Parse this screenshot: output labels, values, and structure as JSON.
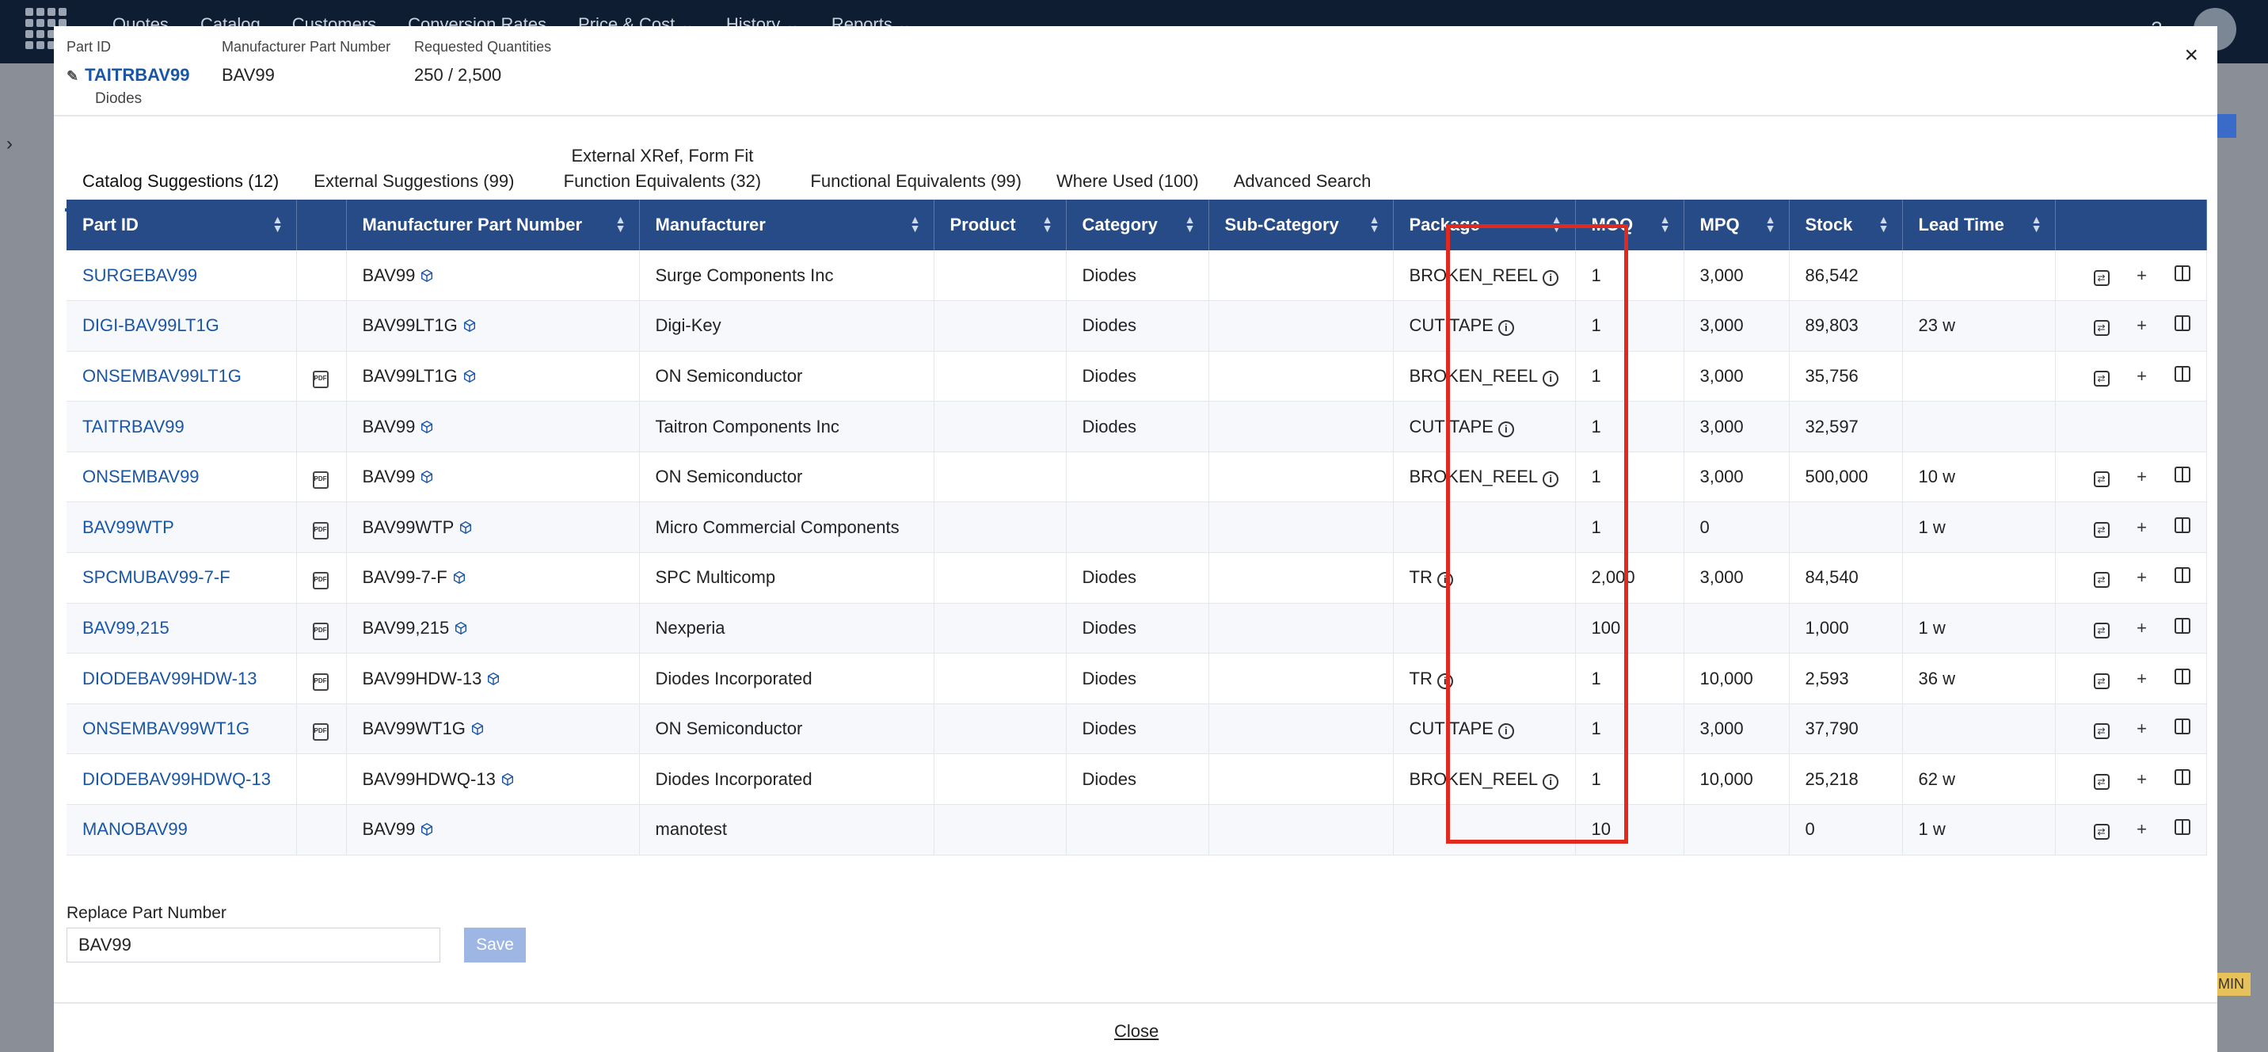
{
  "background": {
    "nav": [
      "Quotes",
      "Catalog",
      "Customers",
      "Conversion Rates",
      "Price & Cost ⌄",
      "History ⌄",
      "Reports ⌄"
    ],
    "badge": "MIN"
  },
  "header": {
    "part_id_label": "Part ID",
    "part_id": "TAITRBAV99",
    "part_category": "Diodes",
    "mpn_label": "Manufacturer Part Number",
    "mpn": "BAV99",
    "qty_label": "Requested Quantities",
    "qty": "250 / 2,500",
    "close_icon": "×"
  },
  "tabs": [
    {
      "label": "Catalog Suggestions (12)",
      "active": true
    },
    {
      "label": "External Suggestions (99)"
    },
    {
      "label": "External XRef, Form Fit Function Equivalents (32)"
    },
    {
      "label": "Functional Equivalents (99)"
    },
    {
      "label": "Where Used (100)"
    },
    {
      "label": "Advanced Search"
    }
  ],
  "table": {
    "columns": [
      "Part ID",
      "",
      "Manufacturer Part Number",
      "Manufacturer",
      "Product",
      "Category",
      "Sub-Category",
      "Package",
      "MOQ",
      "MPQ",
      "Stock",
      "Lead Time",
      ""
    ],
    "rows": [
      {
        "part_id": "SURGEBAV99",
        "pdf": false,
        "mpn": "BAV99",
        "mfr": "Surge Components Inc",
        "product": "",
        "category": "Diodes",
        "sub": "",
        "package": "BROKEN_REEL",
        "moq": "1",
        "mpq": "3,000",
        "stock": "86,542",
        "lead": "",
        "actions": true
      },
      {
        "part_id": "DIGI-BAV99LT1G",
        "pdf": false,
        "mpn": "BAV99LT1G",
        "mfr": "Digi-Key",
        "product": "",
        "category": "Diodes",
        "sub": "",
        "package": "CUT TAPE",
        "moq": "1",
        "mpq": "3,000",
        "stock": "89,803",
        "lead": "23 w",
        "actions": true
      },
      {
        "part_id": "ONSEMBAV99LT1G",
        "pdf": true,
        "mpn": "BAV99LT1G",
        "mfr": "ON Semiconductor",
        "product": "",
        "category": "Diodes",
        "sub": "",
        "package": "BROKEN_REEL",
        "moq": "1",
        "mpq": "3,000",
        "stock": "35,756",
        "lead": "",
        "actions": true
      },
      {
        "part_id": "TAITRBAV99",
        "pdf": false,
        "mpn": "BAV99",
        "mfr": "Taitron Components Inc",
        "product": "",
        "category": "Diodes",
        "sub": "",
        "package": "CUT TAPE",
        "moq": "1",
        "mpq": "3,000",
        "stock": "32,597",
        "lead": "",
        "actions": false
      },
      {
        "part_id": "ONSEMBAV99",
        "pdf": true,
        "mpn": "BAV99",
        "mfr": "ON Semiconductor",
        "product": "",
        "category": "",
        "sub": "",
        "package": "BROKEN_REEL",
        "moq": "1",
        "mpq": "3,000",
        "stock": "500,000",
        "lead": "10 w",
        "actions": true
      },
      {
        "part_id": "BAV99WTP",
        "pdf": true,
        "mpn": "BAV99WTP",
        "mfr": "Micro Commercial Components",
        "product": "",
        "category": "",
        "sub": "",
        "package": "",
        "moq": "1",
        "mpq": "0",
        "stock": "",
        "lead": "1 w",
        "actions": true
      },
      {
        "part_id": "SPCMUBAV99-7-F",
        "pdf": true,
        "mpn": "BAV99-7-F",
        "mfr": "SPC Multicomp",
        "product": "",
        "category": "Diodes",
        "sub": "",
        "package": "TR",
        "moq": "2,000",
        "mpq": "3,000",
        "stock": "84,540",
        "lead": "",
        "actions": true
      },
      {
        "part_id": "BAV99,215",
        "pdf": true,
        "mpn": "BAV99,215",
        "mfr": "Nexperia",
        "product": "",
        "category": "Diodes",
        "sub": "",
        "package": "",
        "moq": "100",
        "mpq": "",
        "stock": "1,000",
        "lead": "1 w",
        "actions": true
      },
      {
        "part_id": "DIODEBAV99HDW-13",
        "pdf": true,
        "mpn": "BAV99HDW-13",
        "mfr": "Diodes Incorporated",
        "product": "",
        "category": "Diodes",
        "sub": "",
        "package": "TR",
        "moq": "1",
        "mpq": "10,000",
        "stock": "2,593",
        "lead": "36 w",
        "actions": true
      },
      {
        "part_id": "ONSEMBAV99WT1G",
        "pdf": true,
        "mpn": "BAV99WT1G",
        "mfr": "ON Semiconductor",
        "product": "",
        "category": "Diodes",
        "sub": "",
        "package": "CUT TAPE",
        "moq": "1",
        "mpq": "3,000",
        "stock": "37,790",
        "lead": "",
        "actions": true
      },
      {
        "part_id": "DIODEBAV99HDWQ-13",
        "pdf": false,
        "mpn": "BAV99HDWQ-13",
        "mfr": "Diodes Incorporated",
        "product": "",
        "category": "Diodes",
        "sub": "",
        "package": "BROKEN_REEL",
        "moq": "1",
        "mpq": "10,000",
        "stock": "25,218",
        "lead": "62 w",
        "actions": true
      },
      {
        "part_id": "MANOBAV99",
        "pdf": false,
        "mpn": "BAV99",
        "mfr": "manotest",
        "product": "",
        "category": "",
        "sub": "",
        "package": "",
        "moq": "10",
        "mpq": "",
        "stock": "0",
        "lead": "1 w",
        "actions": true
      }
    ]
  },
  "replace": {
    "label": "Replace Part Number",
    "value": "BAV99",
    "save_label": "Save"
  },
  "footer": {
    "close_label": "Close"
  },
  "colors": {
    "header_bg": "#274b86",
    "link": "#1a56a6",
    "highlight": "#e0291f"
  }
}
